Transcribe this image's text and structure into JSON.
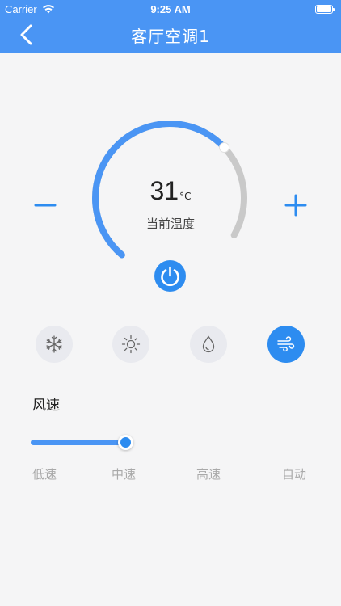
{
  "status_bar": {
    "carrier": "Carrier",
    "time": "9:25 AM"
  },
  "header": {
    "title": "客厅空调1"
  },
  "thermostat": {
    "temperature": "31",
    "unit": "°C",
    "label": "当前温度",
    "level": 0.72
  },
  "modes": [
    {
      "name": "cool",
      "icon": "snowflake-icon",
      "active": false
    },
    {
      "name": "heat",
      "icon": "sun-icon",
      "active": false
    },
    {
      "name": "dry",
      "icon": "droplet-icon",
      "active": false
    },
    {
      "name": "fan",
      "icon": "wind-icon",
      "active": true
    }
  ],
  "wind_speed": {
    "title": "风速",
    "level_fraction": 0.3,
    "options": [
      "低速",
      "中速",
      "高速",
      "自动"
    ]
  },
  "colors": {
    "accent": "#2d8cf0",
    "header": "#4a95f4",
    "track": "#c9c9c9"
  }
}
